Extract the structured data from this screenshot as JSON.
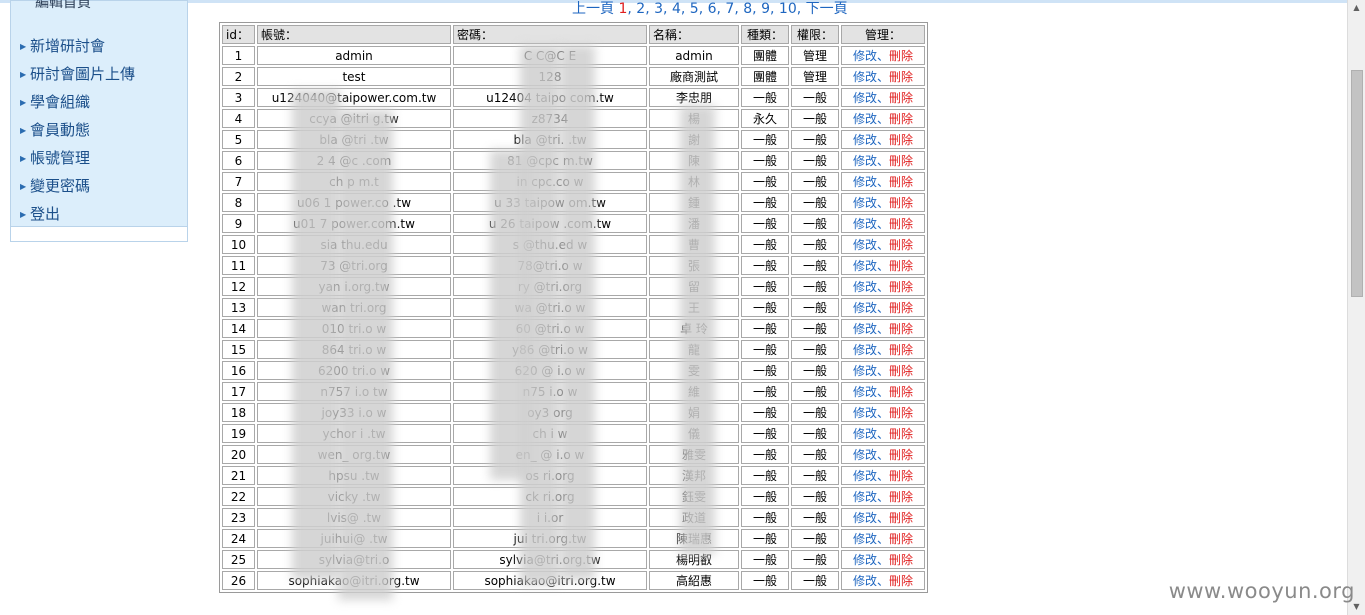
{
  "sidebar": {
    "cut_item": "編輯首頁",
    "items": [
      {
        "label": "新增研討會"
      },
      {
        "label": "研討會圖片上傳"
      },
      {
        "label": "學會組織"
      },
      {
        "label": "會員動態"
      },
      {
        "label": "帳號管理"
      },
      {
        "label": "變更密碼"
      },
      {
        "label": "登出"
      }
    ]
  },
  "pager": {
    "prev": "上一頁",
    "pages": [
      "1",
      "2",
      "3",
      "4",
      "5",
      "6",
      "7",
      "8",
      "9",
      "10"
    ],
    "current": "1",
    "separator": ",",
    "next": "下一頁"
  },
  "table": {
    "headers": {
      "id": "id：",
      "account": "帳號：",
      "password": "密碼：",
      "name": "名稱：",
      "type": "種類：",
      "permission": "權限：",
      "manage": "管理："
    },
    "edit_label": "修改",
    "sep_label": "、",
    "delete_label": "刪除",
    "rows": [
      {
        "id": "1",
        "account": "admin",
        "password": "C C@C E",
        "name": "admin",
        "type": "團體",
        "perm": "管理"
      },
      {
        "id": "2",
        "account": "test",
        "password": "128",
        "name": "廠商測試",
        "type": "團體",
        "perm": "管理"
      },
      {
        "id": "3",
        "account": "u124040@taipower.com.tw",
        "password": "u12404 taipo com.tw",
        "name": "李忠朋",
        "type": "一般",
        "perm": "一般"
      },
      {
        "id": "4",
        "account": "ccya @itri g.tw",
        "password": "z8734",
        "name": "楊",
        "type": "永久",
        "perm": "一般"
      },
      {
        "id": "5",
        "account": "bla @tri .tw",
        "password": "bla @tri. .tw",
        "name": "謝",
        "type": "一般",
        "perm": "一般"
      },
      {
        "id": "6",
        "account": "2 4 @c .com",
        "password": "81 @cpc m.tw",
        "name": "陳",
        "type": "一般",
        "perm": "一般"
      },
      {
        "id": "7",
        "account": "ch p m.t",
        "password": "in cpc.co w",
        "name": "林",
        "type": "一般",
        "perm": "一般"
      },
      {
        "id": "8",
        "account": "u06 1 power.co .tw",
        "password": "u 33 taipow om.tw",
        "name": "鍾",
        "type": "一般",
        "perm": "一般"
      },
      {
        "id": "9",
        "account": "u01 7 power.com.tw",
        "password": "u 26 taipow .com.tw",
        "name": "潘",
        "type": "一般",
        "perm": "一般"
      },
      {
        "id": "10",
        "account": "sia thu.edu",
        "password": "s @thu.ed w",
        "name": "曹",
        "type": "一般",
        "perm": "一般"
      },
      {
        "id": "11",
        "account": "73 @tri.org",
        "password": "78@tri.o w",
        "name": "張",
        "type": "一般",
        "perm": "一般"
      },
      {
        "id": "12",
        "account": "yan i.org.tw",
        "password": "ry @tri.org",
        "name": "留",
        "type": "一般",
        "perm": "一般"
      },
      {
        "id": "13",
        "account": "wan tri.org",
        "password": "wa @tri.o w",
        "name": "王",
        "type": "一般",
        "perm": "一般"
      },
      {
        "id": "14",
        "account": "010 tri.o w",
        "password": "60 @tri.o w",
        "name": "卓 玲",
        "type": "一般",
        "perm": "一般"
      },
      {
        "id": "15",
        "account": "864 tri.o w",
        "password": "y86 @tri.o w",
        "name": "龍",
        "type": "一般",
        "perm": "一般"
      },
      {
        "id": "16",
        "account": "6200 tri.o w",
        "password": "620 @ i.o w",
        "name": "雯",
        "type": "一般",
        "perm": "一般"
      },
      {
        "id": "17",
        "account": "n757 i.o tw",
        "password": "n75 i.o w",
        "name": "維",
        "type": "一般",
        "perm": "一般"
      },
      {
        "id": "18",
        "account": "joy33 i.o w",
        "password": "oy3 org",
        "name": "娟",
        "type": "一般",
        "perm": "一般"
      },
      {
        "id": "19",
        "account": "ychor i .tw",
        "password": "ch i w",
        "name": "儀",
        "type": "一般",
        "perm": "一般"
      },
      {
        "id": "20",
        "account": "wen_ org.tw",
        "password": "en_ @ i.o w",
        "name": "雅雯",
        "type": "一般",
        "perm": "一般"
      },
      {
        "id": "21",
        "account": "hpsu .tw",
        "password": "os ri.org",
        "name": "漢邦",
        "type": "一般",
        "perm": "一般"
      },
      {
        "id": "22",
        "account": "vicky .tw",
        "password": "ck ri.org",
        "name": "鈺雯",
        "type": "一般",
        "perm": "一般"
      },
      {
        "id": "23",
        "account": "lvis@ .tw",
        "password": "i i.or",
        "name": "政道",
        "type": "一般",
        "perm": "一般"
      },
      {
        "id": "24",
        "account": "juihui@ .tw",
        "password": "jui tri.org.tw",
        "name": "陳瑞惠",
        "type": "一般",
        "perm": "一般"
      },
      {
        "id": "25",
        "account": "sylvia@tri.o",
        "password": "sylvia@tri.org.tw",
        "name": "楊明叡",
        "type": "一般",
        "perm": "一般"
      },
      {
        "id": "26",
        "account": "sophiakao@itri.org.tw",
        "password": "sophiakao@itri.org.tw",
        "name": "高紹惠",
        "type": "一般",
        "perm": "一般"
      }
    ]
  },
  "watermark": "www.wooyun.org"
}
